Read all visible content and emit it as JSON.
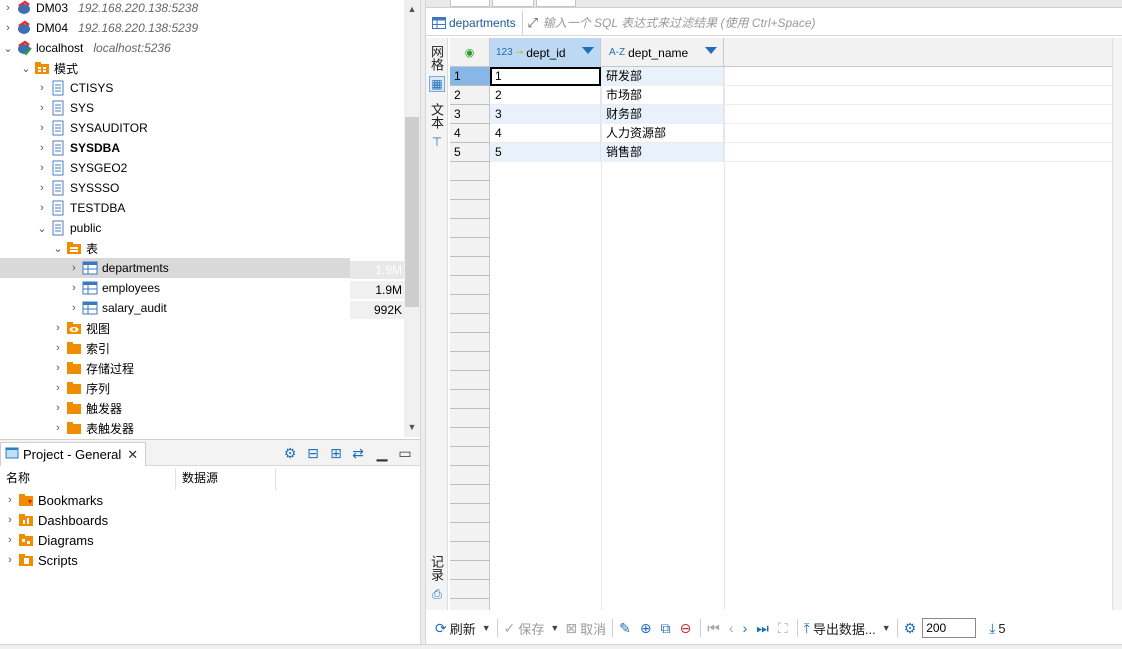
{
  "navigator": {
    "rows": [
      {
        "label": "DM03",
        "sub": "192.168.220.138:5238"
      },
      {
        "label": "DM04",
        "sub": "192.168.220.138:5239"
      },
      {
        "label": "localhost",
        "sub": "localhost:5236"
      },
      {
        "label": "模式"
      },
      {
        "label": "CTISYS"
      },
      {
        "label": "SYS"
      },
      {
        "label": "SYSAUDITOR"
      },
      {
        "label": "SYSDBA"
      },
      {
        "label": "SYSGEO2"
      },
      {
        "label": "SYSSSO"
      },
      {
        "label": "TESTDBA"
      },
      {
        "label": "public"
      },
      {
        "label": "表"
      },
      {
        "label": "departments",
        "size": "1.9M"
      },
      {
        "label": "employees",
        "size": "1.9M"
      },
      {
        "label": "salary_audit",
        "size": "992K"
      },
      {
        "label": "视图"
      },
      {
        "label": "索引"
      },
      {
        "label": "存储过程"
      },
      {
        "label": "序列"
      },
      {
        "label": "触发器"
      },
      {
        "label": "表触发器"
      }
    ]
  },
  "project": {
    "tab_title": "Project - General",
    "columns": [
      "名称",
      "数据源"
    ],
    "items": [
      "Bookmarks",
      "Dashboards",
      "Diagrams",
      "Scripts"
    ]
  },
  "editor": {
    "filter": {
      "table": "departments",
      "placeholder": "输入一个 SQL 表达式来过滤结果 (使用 Ctrl+Space)"
    },
    "side_tabs": {
      "grid": "网格",
      "text": "文本",
      "record": "记录"
    },
    "columns": [
      {
        "type": "123",
        "name": "dept_id"
      },
      {
        "type": "A-Z",
        "name": "dept_name"
      }
    ],
    "rows": [
      {
        "num": "1",
        "dept_id": "1",
        "dept_name": "研发部"
      },
      {
        "num": "2",
        "dept_id": "2",
        "dept_name": "市场部"
      },
      {
        "num": "3",
        "dept_id": "3",
        "dept_name": "财务部"
      },
      {
        "num": "4",
        "dept_id": "4",
        "dept_name": "人力资源部"
      },
      {
        "num": "5",
        "dept_id": "5",
        "dept_name": "销售部"
      }
    ],
    "toolbar": {
      "refresh": "刷新",
      "save": "保存",
      "cancel": "取消",
      "export": "导出数据...",
      "limit": "200",
      "row_count": "5"
    }
  },
  "colors": {
    "accent": "#1e6fb8",
    "selected_row": "#86b7e6",
    "header_active": "#bcd8f2",
    "alt_row": "#e9f2fb",
    "folder": "#f08c00"
  }
}
